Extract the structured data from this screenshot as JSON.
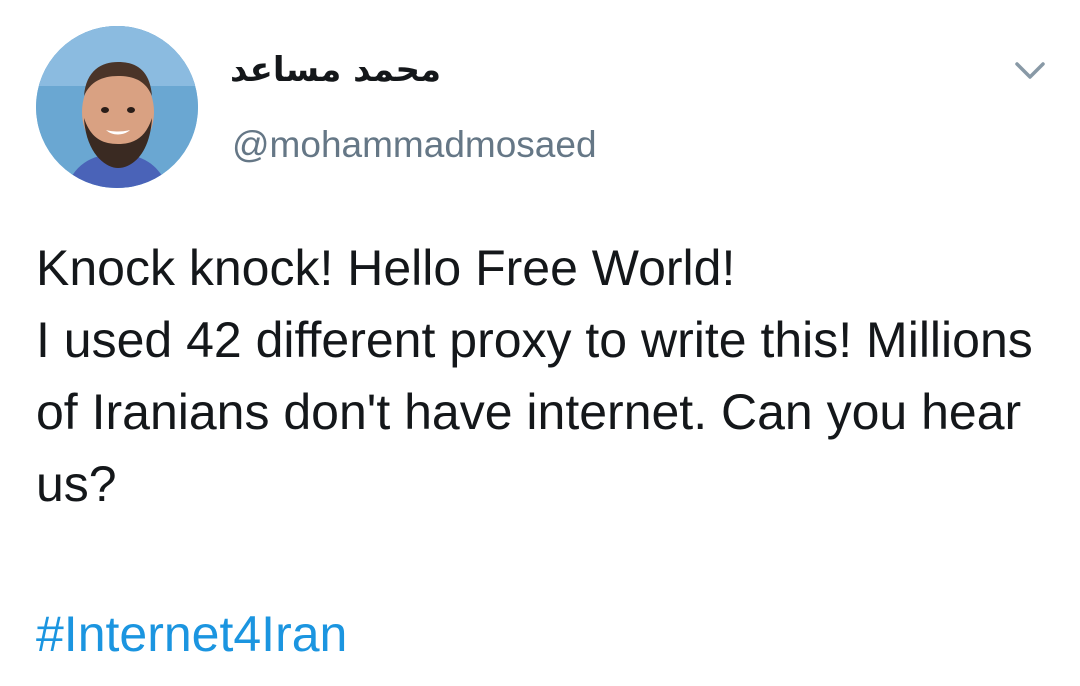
{
  "tweet": {
    "author": {
      "display_name": "محمد مساعد",
      "handle": "@mohammadmosaed",
      "avatar_icon": "profile-photo"
    },
    "menu_icon": "chevron-down-icon",
    "text": "Knock knock! Hello Free World!\nI used 42 different proxy to write this! Millions of Iranians don't have internet. Can you hear us?",
    "hashtag": "#Internet4Iran"
  },
  "colors": {
    "text": "#14171a",
    "secondary": "#657786",
    "link": "#1b95e0",
    "background": "#ffffff"
  }
}
